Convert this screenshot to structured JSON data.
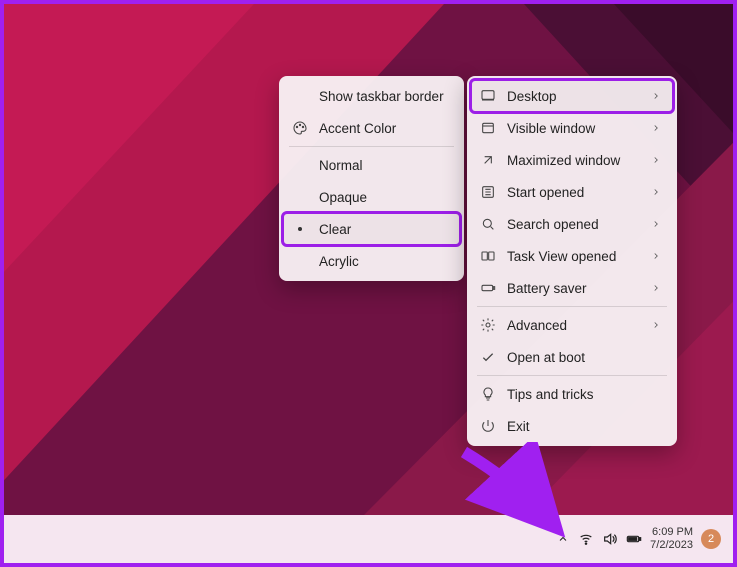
{
  "menu_a": {
    "items": [
      {
        "label": "Show taskbar border"
      },
      {
        "label": "Accent Color"
      },
      {
        "label": "Normal"
      },
      {
        "label": "Opaque"
      },
      {
        "label": "Clear"
      },
      {
        "label": "Acrylic"
      }
    ]
  },
  "menu_b": {
    "items": [
      {
        "label": "Desktop"
      },
      {
        "label": "Visible window"
      },
      {
        "label": "Maximized window"
      },
      {
        "label": "Start opened"
      },
      {
        "label": "Search opened"
      },
      {
        "label": "Task View opened"
      },
      {
        "label": "Battery saver"
      },
      {
        "label": "Advanced"
      },
      {
        "label": "Open at boot"
      },
      {
        "label": "Tips and tricks"
      },
      {
        "label": "Exit"
      }
    ]
  },
  "tray": {
    "time": "6:09 PM",
    "date": "7/2/2023",
    "notif_count": "2"
  }
}
